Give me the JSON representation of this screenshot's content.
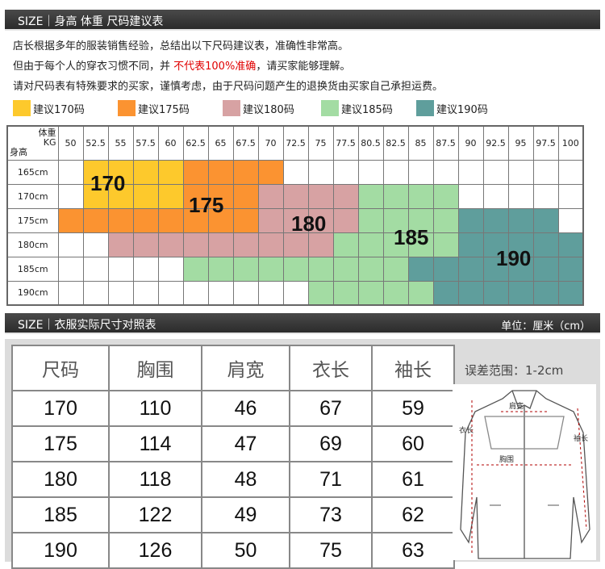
{
  "header1": {
    "title": "SIZE｜身高 体重 尺码建议表"
  },
  "intro": {
    "line1": "店长根据多年的服装销售经验，总结出以下尺码建议表，准确性非常高。",
    "line2_pre": "但由于每个人的穿衣习惯不同，并 ",
    "line2_red": "不代表100%准确",
    "line2_post": "，请买家能够理解。",
    "line3": "请对尺码表有特殊要求的买家，谨慎考虑，由于尺码问题产生的退换货由买家自己承担运费。"
  },
  "legend": [
    {
      "label": "建议170码",
      "color": "#fdc92c"
    },
    {
      "label": "建议175码",
      "color": "#fb9331"
    },
    {
      "label": "建议180码",
      "color": "#d7a2a3"
    },
    {
      "label": "建议185码",
      "color": "#a3dca3"
    },
    {
      "label": "建议190码",
      "color": "#5f9e9c"
    }
  ],
  "grid": {
    "corner_weight": "体重",
    "corner_unit": "KG",
    "corner_height": "身高",
    "weights": [
      "50",
      "52.5",
      "55",
      "57.5",
      "60",
      "62.5",
      "65",
      "67.5",
      "70",
      "72.5",
      "75",
      "77.5",
      "80.5",
      "82.5",
      "85",
      "87.5",
      "90",
      "92.5",
      "95",
      "97.5",
      "100"
    ],
    "heights": [
      "165cm",
      "170cm",
      "175cm",
      "180cm",
      "185cm",
      "190cm"
    ],
    "cells": [
      [
        "",
        "170",
        "170",
        "170",
        "170",
        "175",
        "175",
        "175",
        "175",
        "",
        "",
        "",
        "",
        "",
        "",
        "",
        "",
        "",
        "",
        "",
        ""
      ],
      [
        "",
        "170",
        "170",
        "170",
        "170",
        "175",
        "175",
        "175",
        "180",
        "180",
        "180",
        "180",
        "185",
        "185",
        "185",
        "185",
        "",
        "",
        "",
        "",
        ""
      ],
      [
        "175",
        "175",
        "175",
        "175",
        "175",
        "175",
        "175",
        "175",
        "180",
        "180",
        "180",
        "180",
        "185",
        "185",
        "185",
        "185",
        "190",
        "190",
        "190",
        "190",
        ""
      ],
      [
        "",
        "",
        "180",
        "180",
        "180",
        "180",
        "180",
        "180",
        "180",
        "180",
        "180",
        "185",
        "185",
        "185",
        "185",
        "185",
        "190",
        "190",
        "190",
        "190",
        "190"
      ],
      [
        "",
        "",
        "",
        "",
        "",
        "185",
        "185",
        "185",
        "185",
        "185",
        "185",
        "185",
        "185",
        "185",
        "190",
        "190",
        "190",
        "190",
        "190",
        "190",
        "190"
      ],
      [
        "",
        "",
        "",
        "",
        "",
        "",
        "",
        "",
        "",
        "",
        "185",
        "185",
        "185",
        "185",
        "185",
        "190",
        "190",
        "190",
        "190",
        "190",
        "190"
      ]
    ],
    "labels": [
      "170",
      "175",
      "180",
      "185",
      "190"
    ]
  },
  "header2": {
    "title": "SIZE｜衣服实际尺寸对照表",
    "unit": "单位：厘米（cm）"
  },
  "measure": {
    "headers": [
      "尺码",
      "胸围",
      "肩宽",
      "衣长",
      "袖长"
    ],
    "rows": [
      [
        "170",
        "110",
        "46",
        "67",
        "59"
      ],
      [
        "175",
        "114",
        "47",
        "69",
        "60"
      ],
      [
        "180",
        "118",
        "48",
        "71",
        "61"
      ],
      [
        "185",
        "122",
        "49",
        "73",
        "62"
      ],
      [
        "190",
        "126",
        "50",
        "75",
        "63"
      ]
    ],
    "note": "误差范围：1-2cm"
  },
  "jacket": {
    "label_length": "衣长",
    "label_shoulder": "肩宽",
    "label_sleeve": "袖长",
    "label_chest": "胸围"
  }
}
